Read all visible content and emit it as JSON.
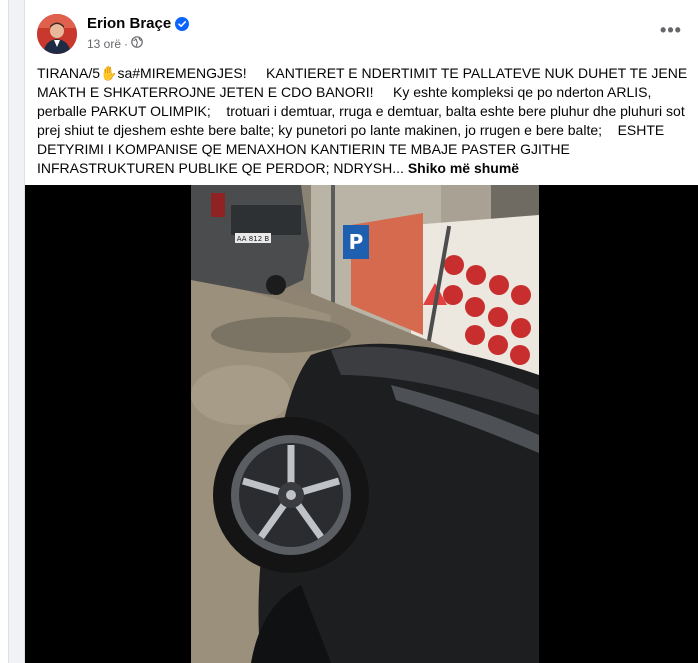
{
  "post": {
    "author": "Erion Braçe",
    "time": "13 orë",
    "privacy_icon": "globe-icon",
    "verified_icon": "verified-badge-icon",
    "more_icon": "more-options-icon",
    "text_part1": "TIRANA/5",
    "text_hand": "✋",
    "text_part2": "sa#MIREMENGJES!     KANTIERET E NDERTIMIT TE PALLATEVE NUK DUHET TE JENE MAKTH E SHKATERROJNE JETEN E CDO BANORI!     Ky eshte kompleksi qe po nderton ARLIS, perballe PARKUT OLIMPIK;    trotuari i demtuar, rruga e demtuar, balta eshte bere pluhur dhe pluhuri sot prej shiut te djeshem eshte bere balte; ky punetori po lante makinen, jo rrugen e bere balte;    ESHTE DETYRIMI I KOMPANISE QE MENAXHON KANTIERIN TE MBAJE PASTER GJITHE INFRASTRUKTUREN PUBLIKE QE PERDOR; NDRYSH...",
    "see_more": "Shiko më shumë",
    "license_plate": "AA 812 B",
    "parking_sign": "P",
    "parking_sign_text": "Parking",
    "colors": {
      "text": "#050505",
      "secondary": "#65676b",
      "verified": "#0866ff",
      "background": "#f0f2f5"
    }
  }
}
